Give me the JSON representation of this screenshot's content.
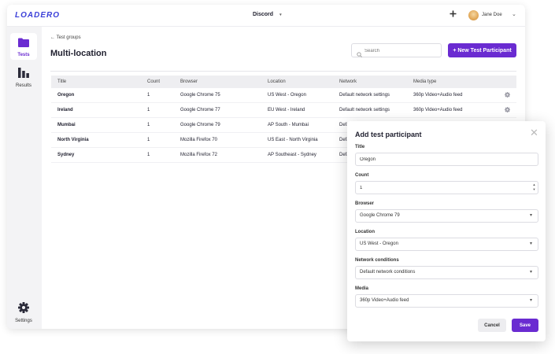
{
  "topbar": {
    "logo": "LOADERO",
    "project": "Discord",
    "project_caret": "▾",
    "add_icon": "plus-icon",
    "user_name": "Jane Doe",
    "user_caret": "⌄"
  },
  "sidebar": {
    "items": [
      {
        "label": "Tests",
        "icon": "folder-icon"
      },
      {
        "label": "Results",
        "icon": "bar-chart-icon"
      },
      {
        "label": "Settings",
        "icon": "gear-icon"
      }
    ]
  },
  "main": {
    "back_label": "Test groups",
    "title": "Multi-location",
    "search_placeholder": "Search",
    "new_button": "+ New Test Participant",
    "table": {
      "headers": [
        "Title",
        "Count",
        "Browser",
        "Location",
        "Network",
        "Media type"
      ],
      "rows": [
        [
          "Oregon",
          "1",
          "Google Chrome 75",
          "US West - Oregon",
          "Default network settings",
          "360p Video+Audio feed"
        ],
        [
          "Ireland",
          "1",
          "Google Chrome 77",
          "EU West - Ireland",
          "Default network settings",
          "360p Video+Audio feed"
        ],
        [
          "Mumbai",
          "1",
          "Google Chrome 79",
          "AP South - Mumbai",
          "Defa",
          ""
        ],
        [
          "North Virginia",
          "1",
          "Mozilla Firefox 70",
          "US East - North Virginia",
          "Defa",
          ""
        ],
        [
          "Sydney",
          "1",
          "Mozilla Firefox 72",
          "AP Southeast - Sydney",
          "Defa",
          ""
        ]
      ]
    }
  },
  "modal": {
    "title": "Add test participant",
    "close_glyph": "✕",
    "fields": {
      "title": {
        "label": "Title",
        "value": "Oregon"
      },
      "count": {
        "label": "Count",
        "value": "1"
      },
      "browser": {
        "label": "Browser",
        "value": "Google Chrome 79"
      },
      "location": {
        "label": "Location",
        "value": "US West - Oregon"
      },
      "network": {
        "label": "Network conditions",
        "value": "Default network conditions"
      },
      "media": {
        "label": "Media",
        "value": "360p Video+Audio feed"
      }
    },
    "caret_glyph": "▾",
    "stepper_up": "▲",
    "stepper_down": "▼",
    "cancel": "Cancel",
    "save": "Save"
  },
  "colors": {
    "accent": "#6a2bd1",
    "logo": "#3b3fd8"
  }
}
